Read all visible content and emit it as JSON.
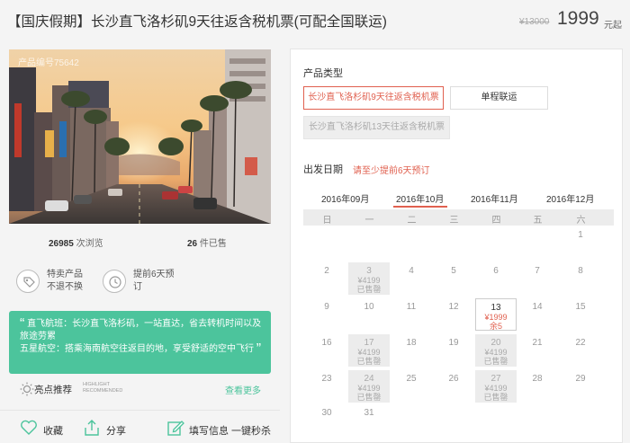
{
  "header": {
    "title": "【国庆假期】长沙直飞洛杉矶9天往返含税机票(可配全国联运)",
    "original_price": "¥13000",
    "price": "1999",
    "price_suffix": "元起"
  },
  "product": {
    "photo_id": "产品编号75642",
    "views_count": "26985",
    "views_label": "次浏览",
    "sold_count": "26",
    "sold_label": "件已售"
  },
  "features": [
    {
      "icon": "tag-icon",
      "line1": "特卖产品",
      "line2": "不退不换"
    },
    {
      "icon": "clock-icon",
      "line1": "提前6天预",
      "line2": "订"
    }
  ],
  "highlights_box": {
    "line1": "直飞航班：长沙直飞洛杉矶，一站直达，省去转机时间以及",
    "line2": "旅途劳累",
    "line3": "五星航空：搭乘海南航空往返目的地，享受舒适的空中飞行"
  },
  "highlight_bar": {
    "title": "亮点推荐",
    "en_line1": "HIGHLIGHT",
    "en_line2": "RECOMMENDED",
    "more": "查看更多"
  },
  "actions": {
    "favorite": "收藏",
    "share": "分享",
    "fill_info": "填写信息 一键秒杀"
  },
  "booking": {
    "type_label": "产品类型",
    "options": [
      {
        "label": "长沙直飞洛杉矶9天往返含税机票",
        "state": "selected"
      },
      {
        "label": "单程联运",
        "state": "normal"
      },
      {
        "label": "长沙直飞洛杉矶13天往返含税机票",
        "state": "disabled"
      }
    ],
    "date_label": "出发日期",
    "date_hint": "请至少提前6天预订",
    "months": [
      "2016年09月",
      "2016年10月",
      "2016年11月",
      "2016年12月"
    ],
    "active_month": "2016年10月",
    "weekdays": [
      "日",
      "一",
      "二",
      "三",
      "四",
      "五",
      "六"
    ]
  },
  "calendar": [
    {
      "day": "1",
      "price": "",
      "status": ""
    },
    {
      "day": "2",
      "price": "",
      "status": ""
    },
    {
      "day": "3",
      "price": "¥4199",
      "status": "已售罄"
    },
    {
      "day": "4",
      "price": "",
      "status": ""
    },
    {
      "day": "5",
      "price": "",
      "status": ""
    },
    {
      "day": "6",
      "price": "",
      "status": ""
    },
    {
      "day": "7",
      "price": "",
      "status": ""
    },
    {
      "day": "8",
      "price": "",
      "status": ""
    },
    {
      "day": "9",
      "price": "",
      "status": ""
    },
    {
      "day": "10",
      "price": "",
      "status": ""
    },
    {
      "day": "11",
      "price": "",
      "status": ""
    },
    {
      "day": "12",
      "price": "",
      "status": ""
    },
    {
      "day": "13",
      "price": "¥1999",
      "status": "余5"
    },
    {
      "day": "14",
      "price": "",
      "status": ""
    },
    {
      "day": "15",
      "price": "",
      "status": ""
    },
    {
      "day": "16",
      "price": "",
      "status": ""
    },
    {
      "day": "17",
      "price": "¥4199",
      "status": "已售罄"
    },
    {
      "day": "18",
      "price": "",
      "status": ""
    },
    {
      "day": "19",
      "price": "",
      "status": ""
    },
    {
      "day": "20",
      "price": "¥4199",
      "status": "已售罄"
    },
    {
      "day": "21",
      "price": "",
      "status": ""
    },
    {
      "day": "22",
      "price": "",
      "status": ""
    },
    {
      "day": "23",
      "price": "",
      "status": ""
    },
    {
      "day": "24",
      "price": "¥4199",
      "status": "已售罄"
    },
    {
      "day": "25",
      "price": "",
      "status": ""
    },
    {
      "day": "26",
      "price": "",
      "status": ""
    },
    {
      "day": "27",
      "price": "¥4199",
      "status": "已售罄"
    },
    {
      "day": "28",
      "price": "",
      "status": ""
    },
    {
      "day": "29",
      "price": "",
      "status": ""
    },
    {
      "day": "30",
      "price": "",
      "status": ""
    },
    {
      "day": "31",
      "price": "",
      "status": ""
    }
  ],
  "colors": {
    "accent": "#e0604f",
    "green": "#4cc49c"
  }
}
